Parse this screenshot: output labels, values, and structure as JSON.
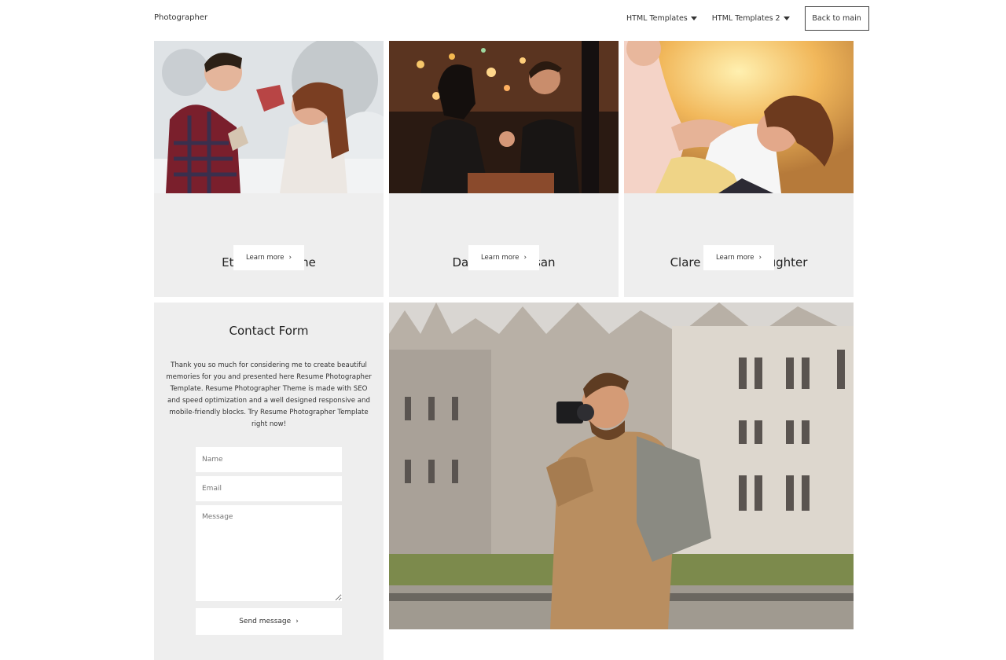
{
  "header": {
    "brand": "Photographer",
    "nav": [
      {
        "label": "HTML Templates",
        "icon": "caret-down-icon"
      },
      {
        "label": "HTML Templates 2",
        "icon": "caret-down-icon"
      }
    ],
    "back_button": "Back to main"
  },
  "cards": [
    {
      "title": "Ethan and Anne",
      "button": "Learn more",
      "icon": "chevron-right-icon",
      "image": "couple-winter-photo"
    },
    {
      "title": "Daniel and Susan",
      "button": "Learn more",
      "icon": "chevron-right-icon",
      "image": "couple-dinner-photo"
    },
    {
      "title": "Clare and her daughter",
      "button": "Learn more",
      "icon": "chevron-right-icon",
      "image": "mother-daughter-photo"
    }
  ],
  "contact": {
    "title": "Contact Form",
    "description": "Thank you so much for considering me to create beautiful memories for you and presented here Resume Photographer Template. Resume Photographer Theme is made with SEO and speed optimization and a well designed responsive and mobile-friendly blocks. Try Resume Photographer Template right now!",
    "name_placeholder": "Name",
    "email_placeholder": "Email",
    "message_placeholder": "Message",
    "send_button": "Send message",
    "send_icon": "chevron-right-icon"
  },
  "feature_image": "photographer-portrait-photo",
  "colors": {
    "card_bg": "#eeeeee",
    "page_bg": "#ffffff",
    "text": "#222222"
  }
}
